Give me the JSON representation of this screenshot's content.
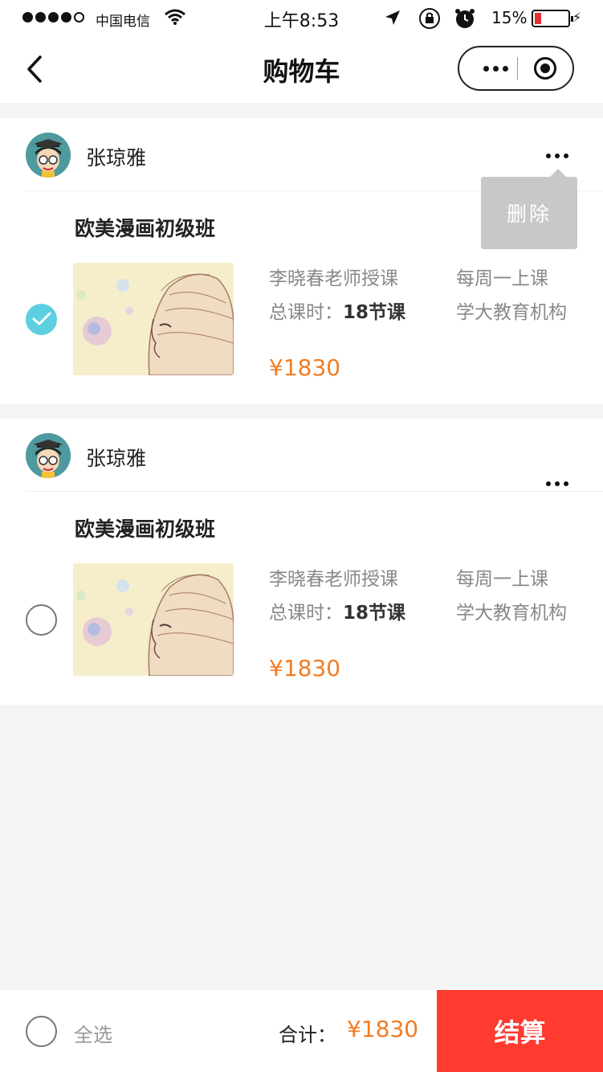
{
  "status_bar": {
    "carrier": "中国电信",
    "time": "上午8:53",
    "battery_percent": "15%",
    "battery_level": 0.15
  },
  "nav": {
    "title": "购物车"
  },
  "cart_items": [
    {
      "teacher_name": "张琼雅",
      "course_title": "欧美漫画初级班",
      "instructor": "李晓春老师授课",
      "hours_label": "总课时：",
      "hours_value": "18节课",
      "schedule": "每周一上课",
      "organization": "学大教育机构",
      "price": "¥1830",
      "selected": true
    },
    {
      "teacher_name": "张琼雅",
      "course_title": "欧美漫画初级班",
      "instructor": "李晓春老师授课",
      "hours_label": "总课时：",
      "hours_value": "18节课",
      "schedule": "每周一上课",
      "organization": "学大教育机构",
      "price": "¥1830",
      "selected": false
    }
  ],
  "delete_popup": {
    "label": "删除"
  },
  "bottom_bar": {
    "select_all_label": "全选",
    "total_label": "合计：",
    "total_value": "¥1830",
    "checkout_label": "结算"
  },
  "colors": {
    "accent_price": "#f27c22",
    "checkout_bg": "#ff3a2f",
    "checked": "#5ccfe0"
  }
}
